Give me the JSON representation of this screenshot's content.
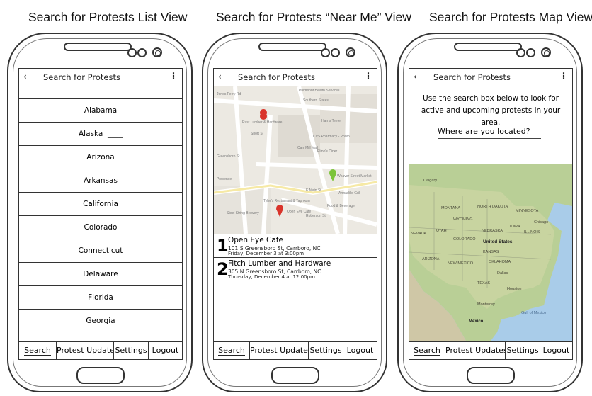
{
  "views": {
    "list": {
      "heading": "Search for Protests List View",
      "screen_title": "Search for Protests",
      "states": [
        "Alabama",
        "Alaska",
        "Arizona",
        "Arkansas",
        "California",
        "Colorado",
        "Connecticut",
        "Delaware",
        "Florida",
        "Georgia"
      ]
    },
    "near": {
      "heading": "Search for Protests “Near Me” View",
      "screen_title": "Search for Protests",
      "map_labels": {
        "l1": "Piedmont Health Services",
        "l2": "Southern States",
        "l3": "Rust Lumber & Hardware",
        "l4": "Harris Teeter",
        "l5": "CVS Pharmacy - Photo",
        "l6": "Carr Mill Mall",
        "l7": "Elmo's Diner",
        "l8": "Weaver Street Market",
        "l9": "Armadillo Grill",
        "l10": "Tyler's Restaurant & Taproom",
        "l11": "Open Eye Cafe",
        "l12": "Steel String Brewery",
        "l13": "Provence",
        "l14": "Short St",
        "l15": "E Main St",
        "l16": "Roberson St",
        "l17": "Food & Beverage",
        "l18": "Jones Ferry Rd",
        "l19": "Greensboro St"
      },
      "results": [
        {
          "num": "1",
          "name": "Open Eye Cafe",
          "addr": "101 S Greensboro St, Carrboro, NC",
          "time": "Friday, December 3 at 3:00pm"
        },
        {
          "num": "2",
          "name": "Fitch Lumber and Hardware",
          "addr": "305 N Greensboro St, Carrboro, NC",
          "time": "Thursday, December 4 at 12:00pm"
        }
      ]
    },
    "map": {
      "heading": "Search for Protests Map View",
      "screen_title": "Search for Protests",
      "help": "Use the search box below to look for active and upcoming protests in your area.",
      "placeholder": "Where are you located?",
      "map_labels": {
        "calgary": "Calgary",
        "united_states": "United States",
        "mexico": "Mexico",
        "gulf": "Gulf of Mexico",
        "montana": "MONTANA",
        "dakota": "NORTH DAKOTA",
        "minnesota": "MINNESOTA",
        "nevada": "NEVADA",
        "utah": "UTAH",
        "colorado": "COLORADO",
        "kansas": "KANSAS",
        "oklahoma": "OKLAHOMA",
        "texas": "TEXAS",
        "arizona": "ARIZONA",
        "newmexico": "NEW MEXICO",
        "chicago": "Chicago",
        "dallas": "Dallas",
        "houston": "Houston",
        "monterrey": "Monterrey",
        "nebraska": "NEBRASKA",
        "iowa": "IOWA",
        "illinois": "ILLINOIS",
        "wyoming": "WYOMING"
      }
    }
  },
  "tabs": {
    "search": "Search",
    "updates": "Protest Updates",
    "settings": "Settings",
    "logout": "Logout"
  },
  "icons": {
    "back": "back-arrow-icon",
    "menu": "overflow-menu-icon",
    "pin_red": "#d9342b",
    "pin_green": "#7cc43a"
  }
}
